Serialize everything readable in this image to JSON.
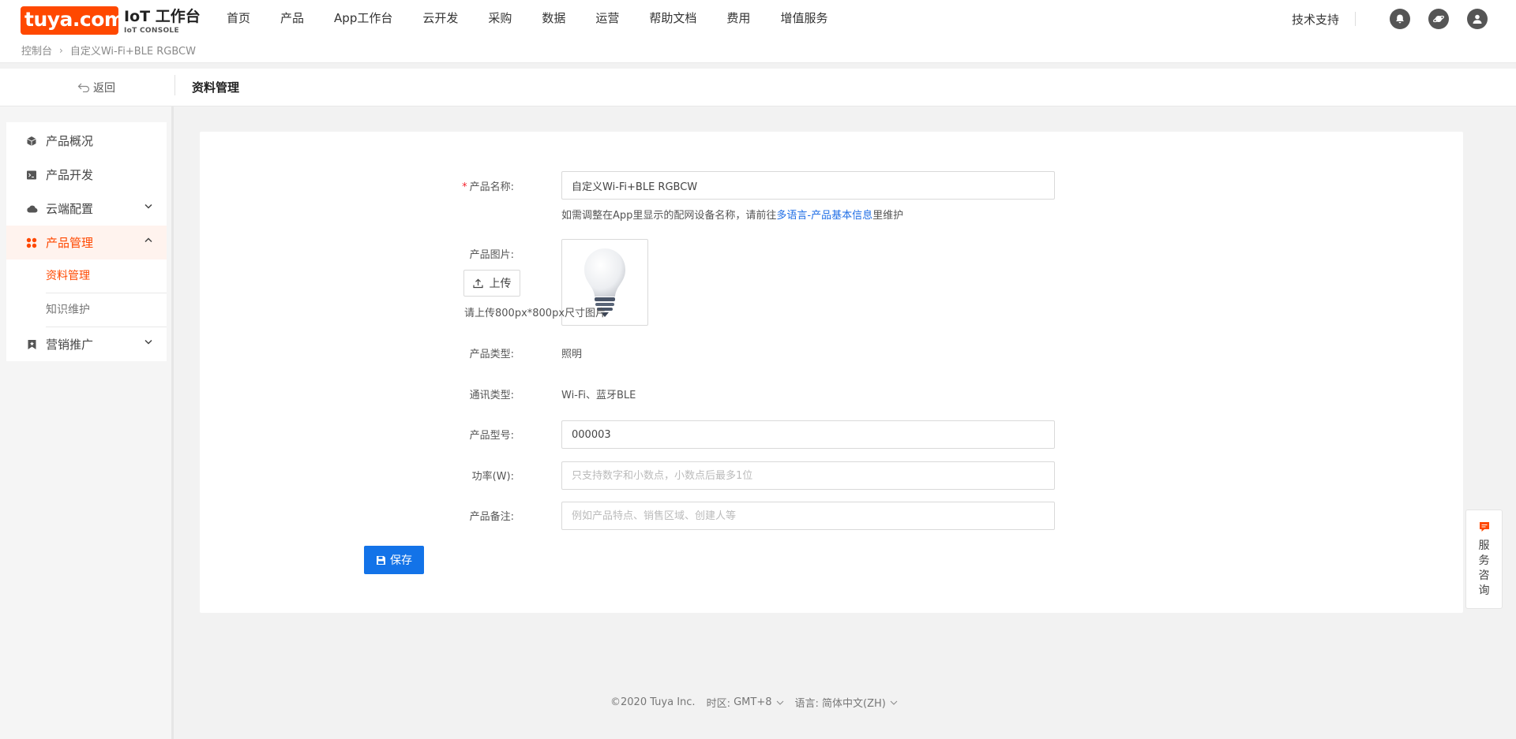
{
  "brand": {
    "logo": "tuya.com",
    "title": "IoT 工作台",
    "subtitle": "IoT CONSOLE",
    "accent_color": "#ff4800"
  },
  "nav": {
    "items": [
      "首页",
      "产品",
      "App工作台",
      "云开发",
      "采购",
      "数据",
      "运营",
      "帮助文档",
      "费用",
      "增值服务"
    ]
  },
  "topright": {
    "support": "技术支持",
    "icons": [
      "bell-icon",
      "planet-icon",
      "user-icon"
    ]
  },
  "breadcrumb": {
    "root": "控制台",
    "current": "自定义Wi-Fi+BLE RGBCW"
  },
  "subheader": {
    "back": "返回",
    "title": "资料管理"
  },
  "sidebar": {
    "items": [
      {
        "label": "产品概况",
        "icon": "cube-icon"
      },
      {
        "label": "产品开发",
        "icon": "terminal-icon"
      },
      {
        "label": "云端配置",
        "icon": "cloud-icon"
      },
      {
        "label": "产品管理",
        "icon": "grid-icon"
      },
      {
        "label": "营销推广",
        "icon": "bookmark-icon"
      }
    ],
    "subitems": [
      "资料管理",
      "知识维护"
    ]
  },
  "form": {
    "name_label": "产品名称:",
    "name_value": "自定义Wi-Fi+BLE RGBCW",
    "name_hint_prefix": "如需调整在App里显示的配网设备名称，请前往",
    "name_hint_link": "多语言-产品基本信息",
    "name_hint_suffix": "里维护",
    "image_label": "产品图片:",
    "upload_label": "上传",
    "upload_hint": "请上传800px*800px尺寸图片",
    "type_label": "产品类型:",
    "type_value": "照明",
    "comm_label": "通讯类型:",
    "comm_value": "Wi-Fi、蓝牙BLE",
    "model_label": "产品型号:",
    "model_value": "000003",
    "power_label": "功率(W):",
    "power_placeholder": "只支持数字和小数点，小数点后最多1位",
    "remark_label": "产品备注:",
    "remark_placeholder": "例如产品特点、销售区域、创建人等",
    "save_label": "保存"
  },
  "footer": {
    "copyright": "©2020 Tuya Inc.",
    "tz_label": "时区:",
    "tz_value": "GMT+8",
    "lang_label": "语言:",
    "lang_value": "简体中文(ZH)"
  },
  "service": {
    "label": "服务咨询"
  }
}
